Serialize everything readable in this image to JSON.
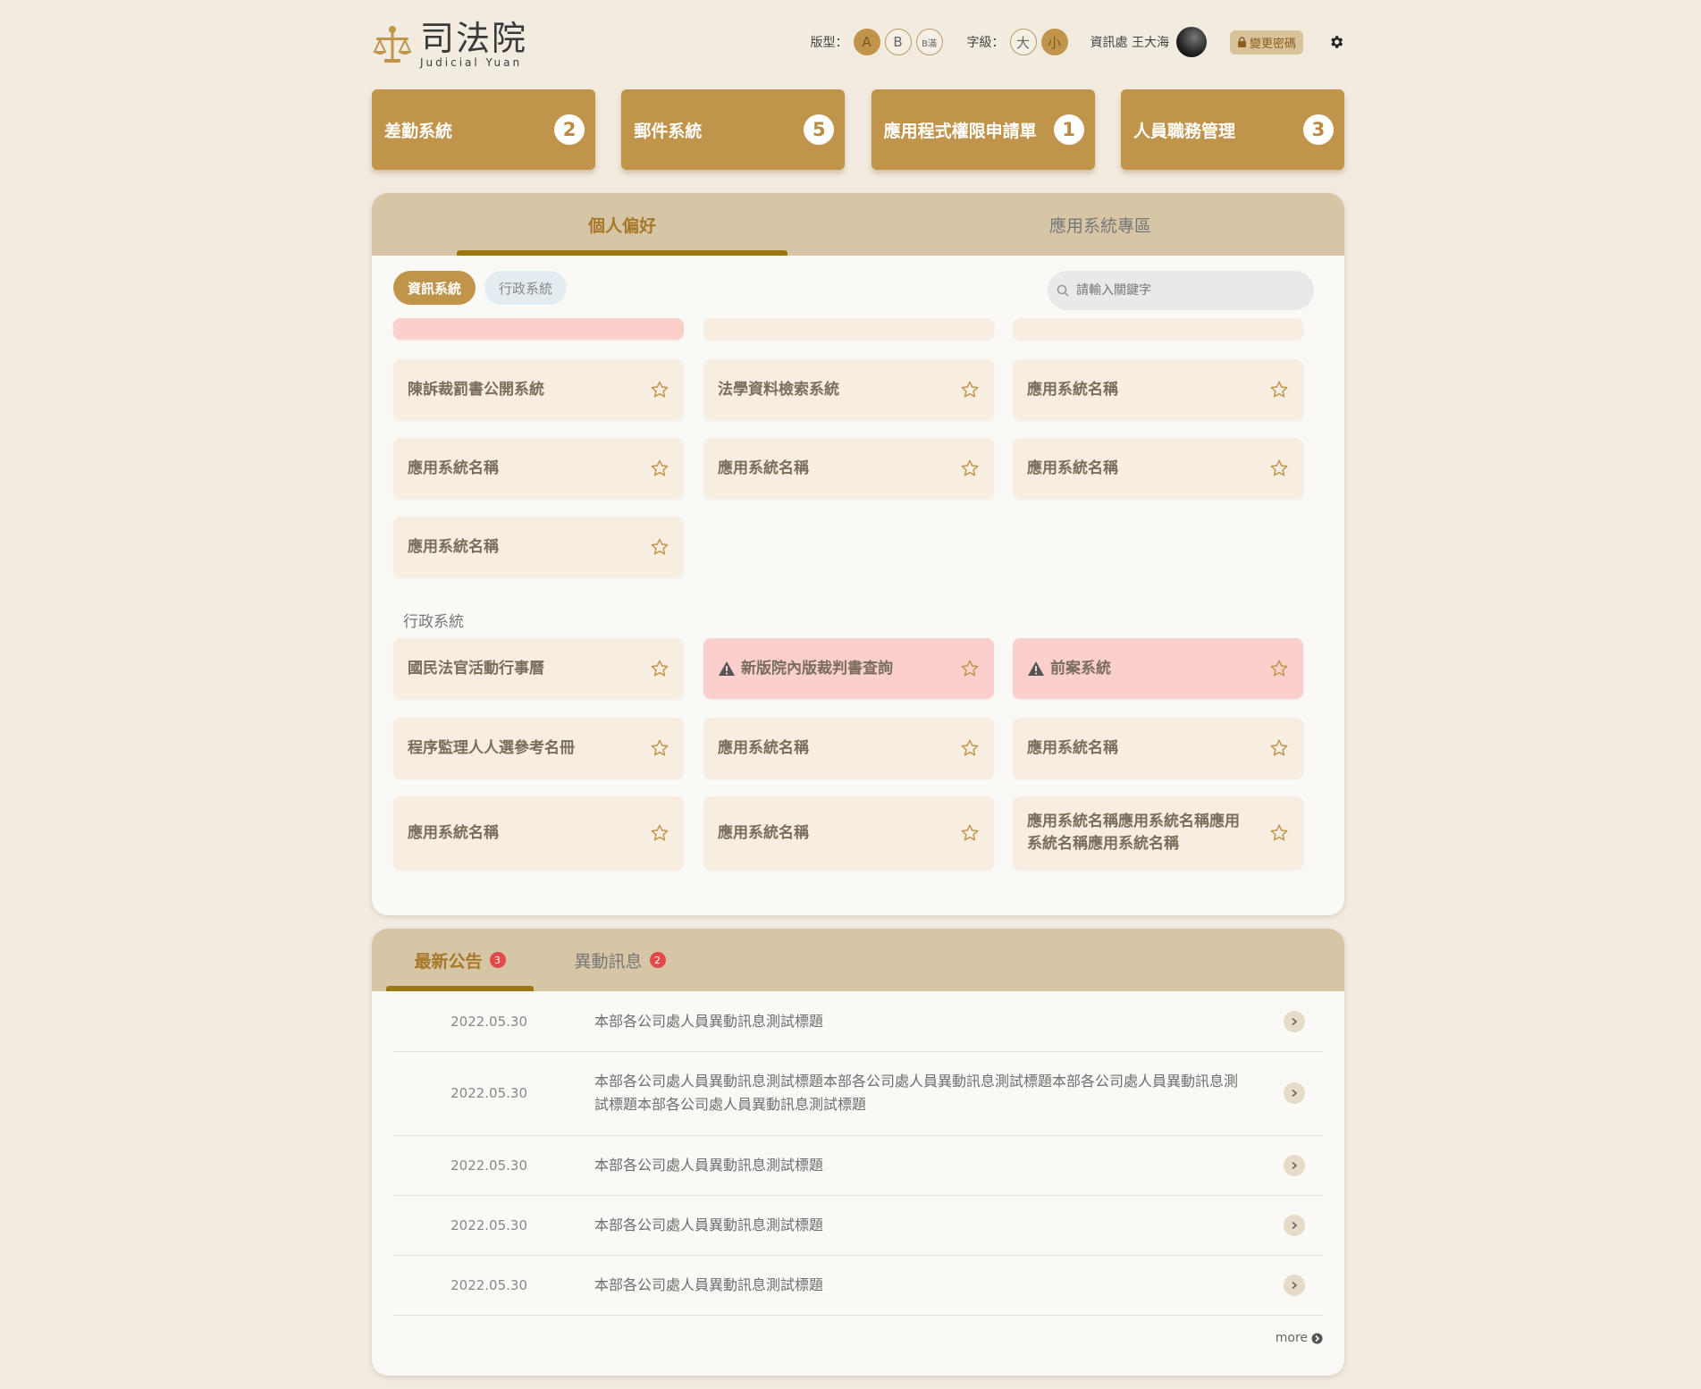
{
  "header": {
    "logo_zh": "司法院",
    "logo_en": "Judicial Yuan",
    "layout_label": "版型：",
    "layout_options": [
      "A",
      "B",
      "B滿"
    ],
    "font_label": "字級：",
    "font_options": [
      "大",
      "小"
    ],
    "user": "資訊處 王大海",
    "change_password": "變更密碼"
  },
  "quick_cards": [
    {
      "label": "差勤系統",
      "count": "2"
    },
    {
      "label": "郵件系統",
      "count": "5"
    },
    {
      "label": "應用程式權限申請單",
      "count": "1"
    },
    {
      "label": "人員職務管理",
      "count": "3"
    }
  ],
  "apps_panel": {
    "tabs": [
      "個人偏好",
      "應用系統專區"
    ],
    "filters": [
      "資訊系統",
      "行政系統"
    ],
    "search_placeholder": "請輸入關鍵字",
    "info_apps": [
      "陳訴裁罰書公開系統",
      "法學資料檢索系統",
      "應用系統名稱",
      "應用系統名稱",
      "應用系統名稱",
      "應用系統名稱",
      "應用系統名稱"
    ],
    "admin_section_title": "行政系統",
    "admin_apps": [
      {
        "name": "國民法官活動行事曆",
        "warn": false
      },
      {
        "name": "新版院內版裁判書查詢",
        "warn": true
      },
      {
        "name": "前案系統",
        "warn": true
      },
      {
        "name": "程序監理人人選參考名冊",
        "warn": false
      },
      {
        "name": "應用系統名稱",
        "warn": false
      },
      {
        "name": "應用系統名稱",
        "warn": false
      },
      {
        "name": "應用系統名稱",
        "warn": false
      },
      {
        "name": "應用系統名稱",
        "warn": false
      },
      {
        "name": "應用系統名稱應用系統名稱應用系統名稱應用系統名稱",
        "warn": false
      }
    ]
  },
  "news_panel": {
    "tabs": [
      {
        "label": "最新公告",
        "badge": "3"
      },
      {
        "label": "異動訊息",
        "badge": "2"
      }
    ],
    "items": [
      {
        "date": "2022.05.30",
        "title": "本部各公司處人員異動訊息測試標題"
      },
      {
        "date": "2022.05.30",
        "title": "本部各公司處人員異動訊息測試標題本部各公司處人員異動訊息測試標題本部各公司處人員異動訊息測試標題本部各公司處人員異動訊息測試標題"
      },
      {
        "date": "2022.05.30",
        "title": "本部各公司處人員異動訊息測試標題"
      },
      {
        "date": "2022.05.30",
        "title": "本部各公司處人員異動訊息測試標題"
      },
      {
        "date": "2022.05.30",
        "title": "本部各公司處人員異動訊息測試標題"
      }
    ],
    "more": "more"
  },
  "colors": {
    "accent": "#c0944a",
    "background": "#f2ebe0",
    "tab_bar": "#d6c6a6",
    "warn": "#fbd0cc",
    "badge": "#e24a4a"
  }
}
